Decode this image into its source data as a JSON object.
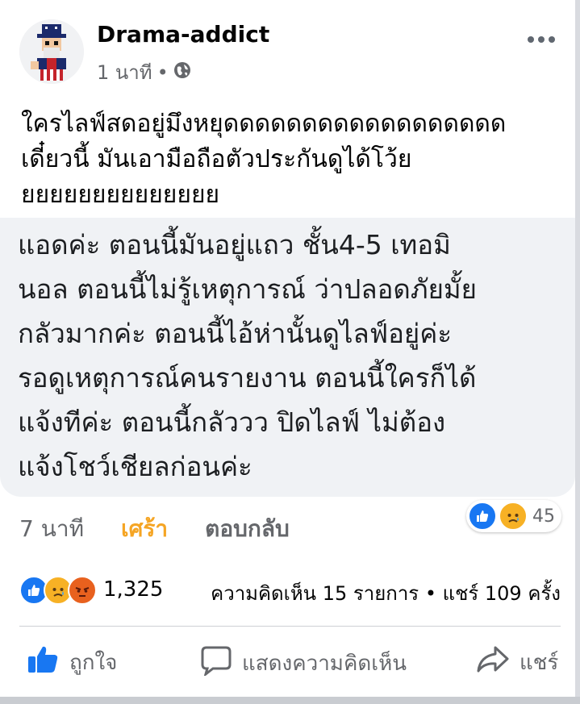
{
  "post": {
    "author": "Drama-addict",
    "time": "1 นาที",
    "separator": "•",
    "text": "ใครไลฟ์สดอยู่มึงหยุดดดดดดดดดดดดดดดดดด\nเดี๋ยวนี้ มันเอามือถือตัวประกันดูได้โว้ย\nยยยยยยยยยยยยยย"
  },
  "comment": {
    "text": "แอดค่ะ ตอนนี้มันอยู่แถว ชั้น4-5 เทอมิ\nนอล ตอนนี้ไม่รู้เหตุการณ์ ว่าปลอดภัยมั้ย\nกลัวมากค่ะ ตอนนี้ไอ้ห่านั้นดูไลฟ์อยู่ค่ะ\nรอดูเหตุการณ์คนรายงาน ตอนนี้ใครก็ได้\nแจ้งทีค่ะ ตอนนี้กลัววว ปิดไลฟ์ ไม่ต้อง\nแจ้งโชว์เชียลก่อนค่ะ",
    "time": "7 นาที",
    "reaction_label": "เศร้า",
    "reply_label": "ตอบกลับ",
    "reaction_count": "45"
  },
  "summary": {
    "reaction_count": "1,325",
    "comments_shares": "ความคิดเห็น 15 รายการ • แชร์ 109 ครั้ง"
  },
  "actions": {
    "like": "ถูกใจ",
    "comment": "แสดงความคิดเห็น",
    "share": "แชร์"
  },
  "colors": {
    "like_blue": "#1877f2",
    "sad_yellow": "#f7b125",
    "angry_orange": "#e8611e",
    "comment_bg": "#f0f2f5"
  },
  "icons": [
    "globe-icon",
    "more-options-icon",
    "like-reaction-icon",
    "sad-reaction-icon",
    "angry-reaction-icon",
    "thumbs-up-icon",
    "speech-bubble-icon",
    "share-arrow-icon"
  ]
}
